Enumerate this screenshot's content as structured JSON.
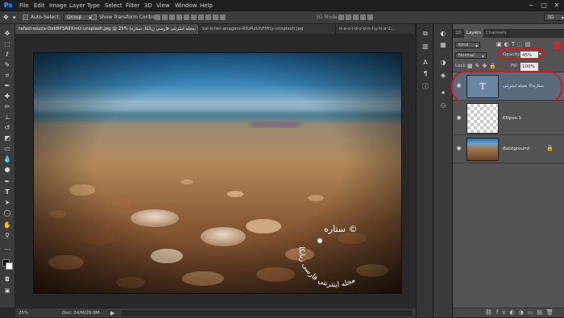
{
  "app": {
    "logo": "Ps"
  },
  "menu": [
    "File",
    "Edit",
    "Image",
    "Layer",
    "Type",
    "Select",
    "Filter",
    "3D",
    "View",
    "Window",
    "Help"
  ],
  "workspace": "3D",
  "window_controls": [
    "−",
    "□",
    "✕"
  ],
  "options": {
    "auto_select_label": "Auto-Select:",
    "auto_select_value": "Group",
    "transform_label": "Show Transform Controls",
    "mode3d_label": "3D Mode:"
  },
  "tabs": [
    "rafael-souza-QxkBP3A9XmU-unsplash.jpg @ 25% (مجله اینترنتی فارسی زبانکا, ستاره, RGB/8) *",
    "sai-kiran-anagani-R5zRzUhFMhy-unsplash.jpg",
    "d-a-v-i-d-s-o-n-l-u-n-a-2..."
  ],
  "status": {
    "zoom": "25%",
    "doc": "Doc: 24/M/29.9M"
  },
  "panel": {
    "tabs": [
      "3D",
      "Layers",
      "Channels"
    ],
    "kind": "Kind",
    "blend_mode": "Normal",
    "opacity_label": "Opacity:",
    "opacity_value": "45%",
    "lock_label": "Lock:",
    "fill_label": "Fill:",
    "fill_value": "100%",
    "layers": [
      {
        "name": "ستاره© مجله اینترنتی",
        "type": "text",
        "thumb_glyph": "T"
      },
      {
        "name": "Ellipse 1",
        "type": "shape"
      },
      {
        "name": "Background",
        "type": "image"
      }
    ]
  },
  "watermark_text": "ستاره ©",
  "watermark_arc": "مجله اینترنتی فارسی زبانکا"
}
